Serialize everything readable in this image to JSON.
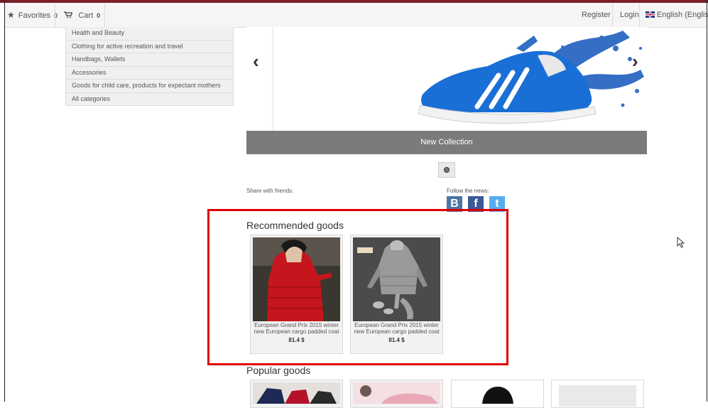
{
  "navbar": {
    "favorites_label": "Favorites",
    "favorites_count": "0",
    "cart_label": "Cart",
    "cart_count": "0",
    "register_label": "Register",
    "login_label": "Login",
    "language_label": "English (English)"
  },
  "categories": [
    "Health and Beauty",
    "Clothing for active recreation and travel",
    "Handbags, Wallets",
    "Accessories",
    "Goods for child care, products for expectant mothers",
    "All categories"
  ],
  "carousel": {
    "caption": "New Collection",
    "prev_glyph": "‹",
    "next_glyph": "›"
  },
  "share": {
    "share_label": "Share with friends:",
    "follow_label": "Follow the news:",
    "vk_glyph": "B",
    "facebook_glyph": "f",
    "twitter_glyph": "t"
  },
  "recommended": {
    "title": "Recommended goods",
    "items": [
      {
        "name": "European Grand Prix 2015 winter new European cargo padded coat",
        "price": "81.4 $"
      },
      {
        "name": "European Grand Prix 2015 winter new European cargo padded coat",
        "price": "81.4 $"
      }
    ]
  },
  "popular": {
    "title": "Popular goods"
  },
  "colors": {
    "highlight": "#e00000",
    "vk": "#4a76a8",
    "facebook": "#3b5998",
    "twitter": "#55acee",
    "caption_bg": "#7b7b7b"
  }
}
